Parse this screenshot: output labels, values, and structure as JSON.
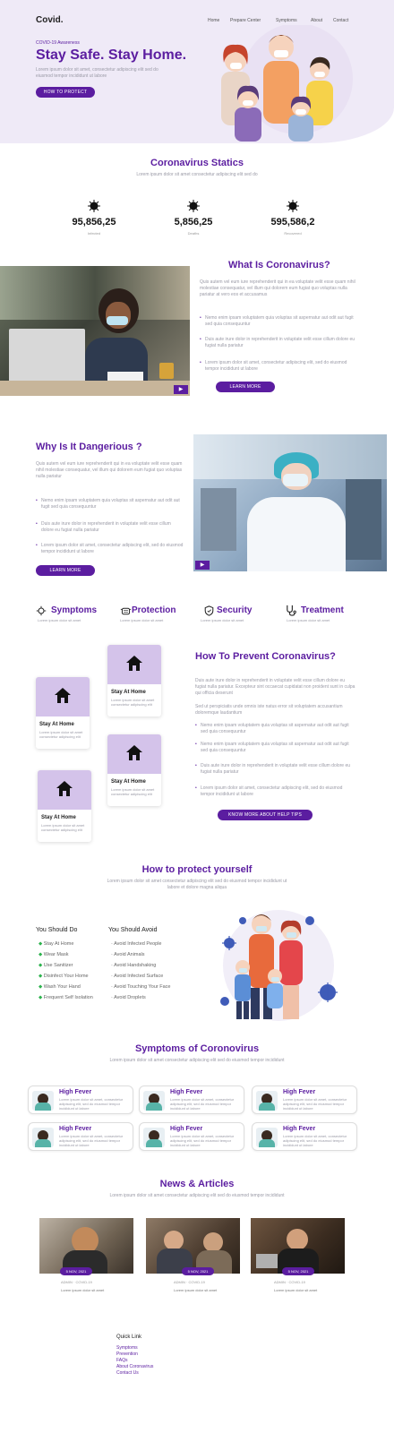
{
  "colors": {
    "accent": "#5b1da0",
    "hero_bg": "#efeaf7",
    "card_img": "#d4c3ea"
  },
  "header": {
    "logo": "Covid.",
    "nav": [
      "Home",
      "Prepare Center",
      "Symptoms",
      "About",
      "Contact"
    ]
  },
  "hero": {
    "small": "COVID-19 Awareness",
    "title": "Stay Safe. Stay Home.",
    "text": "Lorem ipsum dolor sit amet, consectetur adipiscing elit sed do eiusmod tempor incididunt ut labore",
    "button": "HOW TO PROTECT"
  },
  "stats": {
    "title": "Coronavirus Statics",
    "subtitle": "Lorem ipsum dolor sit amet consectetur adipiscing elit sed do",
    "items": [
      {
        "value": "95,856,25",
        "label": "Infected"
      },
      {
        "value": "5,856,25",
        "label": "Deaths"
      },
      {
        "value": "595,586,2",
        "label": "Recovered"
      }
    ]
  },
  "what": {
    "title": "What Is Coronavirus?",
    "text": "Quis autem vel eum iure reprehenderit qui in ea voluptate velit esse quam nihil molestiae consequatur, vel illum qui dolorem eum fugiat quo voluptas nulla pariatur at vero eos et accusamus",
    "bullets": [
      "Nemo enim ipsam voluptatem quia voluptas sit aspernatur aut odit aut fugit sed quia consequuntur",
      "Duis aute irure dolor in reprehenderit in voluptate velit esse cillum dolore eu fugiat nulla pariatur",
      "Lorem ipsum dolor sit amet, consectetur adipiscing elit, sed do eiusmod tempor incididunt ut labore"
    ],
    "button": "LEARN MORE"
  },
  "danger": {
    "title": "Why Is It Dangerious ?",
    "text": "Quis autem vel eum iure reprehenderit qui in ea voluptate velit esse quam nihil molestiae consequatur, vel illum qui dolorem eum fugiat quo voluptas nulla pariatur",
    "bullets": [
      "Nemo enim ipsam voluptatem quia voluptas sit aspernatur aut odit aut fugit sed quia consequuntur",
      "Duis aute irure dolor in reprehenderit in voluptate velit esse cillum dolore eu fugiat nulla pariatur",
      "Lorem ipsum dolor sit amet, consectetur adipiscing elit, sed do eiusmod tempor incididunt ut labore"
    ],
    "button": "LEARN MORE"
  },
  "features": [
    {
      "title": "Symptoms",
      "sub": "Lorem ipsum dolor sit amet"
    },
    {
      "title": "Protection",
      "sub": "Lorem ipsum dolor sit amet"
    },
    {
      "title": "Security",
      "sub": "Lorem ipsum dolor sit amet"
    },
    {
      "title": "Treatment",
      "sub": "Lorem ipsum dolor sit amet"
    }
  ],
  "prevent": {
    "title": "How To Prevent Coronavirus?",
    "text1": "Duis aute irure dolor in reprehenderit in voluptate velit esse cillum dolore eu fugiat nulla pariatur. Excepteur sint occaecat cupidatat non proident sunt in culpa qui officia deserunt",
    "text2": "Sed ut perspiciatis unde omnis iste natus error sit voluptatem accusantium doloremque laudantium",
    "bullets": [
      "Nemo enim ipsam voluptatem quia voluptas sit aspernatur aut odit aut fugit sed quia consequuntur",
      "Nemo enim ipsam voluptatem quia voluptas sit aspernatur aut odit aut fugit sed quia consequuntur",
      "Duis aute irure dolor in reprehenderit in voluptate velit esse cillum dolore eu fugiat nulla pariatur",
      "Lorem ipsum dolor sit amet, consectetur adipiscing elit, sed do eiusmod tempor incididunt ut labore"
    ],
    "button": "KNOW MORE ABOUT HELP TIPS",
    "cards": [
      {
        "title": "Stay At Home",
        "text": "Lorem ipsum dolor sit amet consectetur adipiscing elit"
      },
      {
        "title": "Stay At Home",
        "text": "Lorem ipsum dolor sit amet consectetur adipiscing elit"
      },
      {
        "title": "Stay At Home",
        "text": "Lorem ipsum dolor sit amet consectetur adipiscing elit"
      },
      {
        "title": "Stay At Home",
        "text": "Lorem ipsum dolor sit amet consectetur adipiscing elit"
      }
    ]
  },
  "protect": {
    "title": "How to protect yourself",
    "subtitle": "Lorem ipsum dolor sit amet consectetur adipiscing elit sed do eiusmod tempor incididunt ut labore et dolore magna aliqua",
    "do_title": "You Should Do",
    "do": [
      "Stay At Home",
      "Wear Mask",
      "Use Sanitizer",
      "Disinfect Your Home",
      "Wash Your Hand",
      "Frequent Self Isolation"
    ],
    "avoid_title": "You Should Avoid",
    "avoid": [
      "Avoid Infected People",
      "Avoid Animals",
      "Avoid Handshaking",
      "Avoid Infected Surface",
      "Avoid Touching Your Face",
      "Avoid Droplets"
    ]
  },
  "symptoms": {
    "title": "Symptoms of Coronovirus",
    "subtitle": "Lorem ipsum dolor sit amet consectetur adipiscing elit sed do eiusmod tempor incididunt",
    "items": [
      {
        "title": "High Fever",
        "text": "Lorem ipsum dolor sit amet, consectetur adipiscing elit, sed do eiusmod tempor incididunt ut labore"
      },
      {
        "title": "High Fever",
        "text": "Lorem ipsum dolor sit amet, consectetur adipiscing elit, sed do eiusmod tempor incididunt ut labore"
      },
      {
        "title": "High Fever",
        "text": "Lorem ipsum dolor sit amet, consectetur adipiscing elit, sed do eiusmod tempor incididunt ut labore"
      },
      {
        "title": "High Fever",
        "text": "Lorem ipsum dolor sit amet, consectetur adipiscing elit, sed do eiusmod tempor incididunt ut labore"
      },
      {
        "title": "High Fever",
        "text": "Lorem ipsum dolor sit amet, consectetur adipiscing elit, sed do eiusmod tempor incididunt ut labore"
      },
      {
        "title": "High Fever",
        "text": "Lorem ipsum dolor sit amet, consectetur adipiscing elit, sed do eiusmod tempor incididunt ut labore"
      }
    ]
  },
  "news": {
    "title": "News & Articles",
    "subtitle": "Lorem ipsum dolor sit amet consectetur adipiscing elit sed do eiusmod tempor incididunt",
    "items": [
      {
        "date": "5 NOV, 2021",
        "meta": "ADMIN · COVID-19",
        "title": "Lorem ipsum dolor sit amet"
      },
      {
        "date": "5 NOV, 2021",
        "meta": "ADMIN · COVID-19",
        "title": "Lorem ipsum dolor sit amet"
      },
      {
        "date": "5 NOV, 2021",
        "meta": "ADMIN · COVID-19",
        "title": "Lorem ipsum dolor sit amet"
      }
    ]
  },
  "footer": {
    "title": "Quick Link",
    "links": [
      "Symptoms",
      "Prevention",
      "FAQs",
      "About Coronavirus",
      "Contact Us"
    ]
  }
}
